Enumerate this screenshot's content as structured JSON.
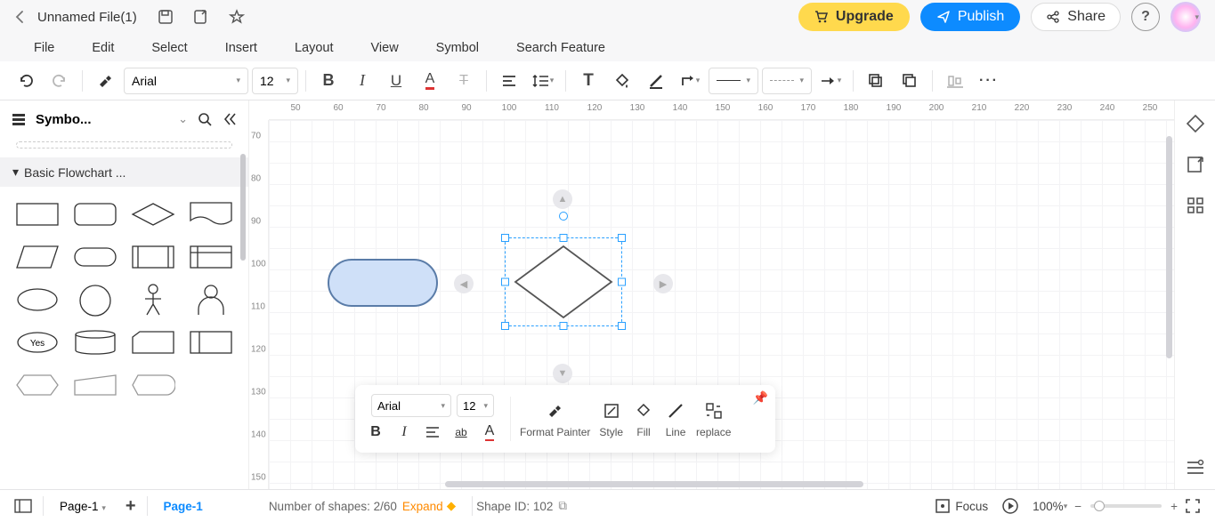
{
  "header": {
    "file_title": "Unnamed File(1)",
    "upgrade": "Upgrade",
    "publish": "Publish",
    "share": "Share"
  },
  "menu": {
    "file": "File",
    "edit": "Edit",
    "select": "Select",
    "insert": "Insert",
    "layout": "Layout",
    "view": "View",
    "symbol": "Symbol",
    "search_feature": "Search Feature"
  },
  "toolbar": {
    "font": "Arial",
    "size": "12"
  },
  "sidebar": {
    "title": "Symbo...",
    "category": "Basic Flowchart ...",
    "yes_label": "Yes"
  },
  "ruler_h": [
    "50",
    "60",
    "70",
    "80",
    "90",
    "100",
    "110",
    "120",
    "130",
    "140",
    "150",
    "160",
    "170",
    "180",
    "190",
    "200",
    "210",
    "220",
    "230",
    "240",
    "250"
  ],
  "ruler_v": [
    "70",
    "80",
    "90",
    "100",
    "110",
    "120",
    "130",
    "140",
    "150"
  ],
  "mini": {
    "font": "Arial",
    "size": "12",
    "format_painter": "Format Painter",
    "style": "Style",
    "fill": "Fill",
    "line": "Line",
    "replace": "replace"
  },
  "tabs": {
    "page_label": "Page-1",
    "active_page": "Page-1"
  },
  "status": {
    "shapes_prefix": "Number of shapes: ",
    "shapes_count": "2/60",
    "expand": "Expand",
    "shape_id_prefix": "Shape ID: ",
    "shape_id": "102",
    "focus": "Focus",
    "zoom": "100%"
  }
}
